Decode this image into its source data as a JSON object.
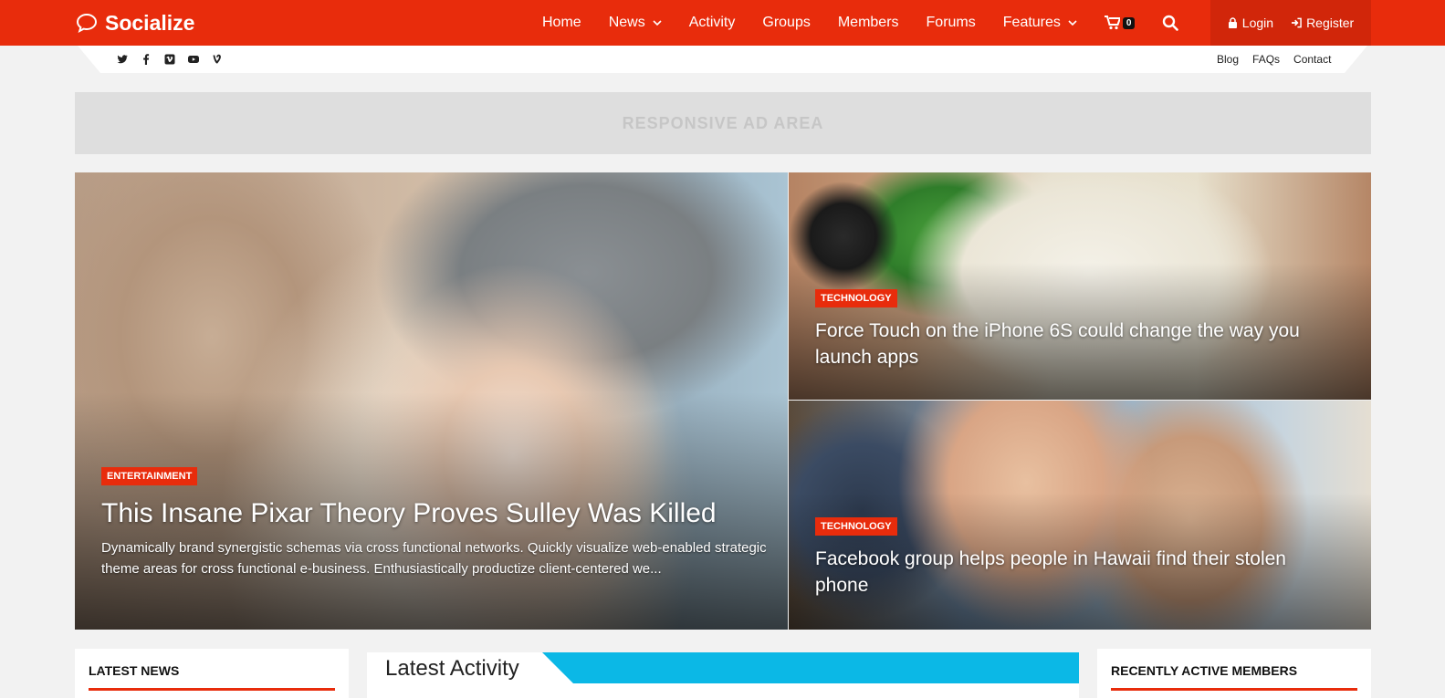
{
  "header": {
    "logo_text": "Socialize",
    "nav": [
      {
        "label": "Home",
        "has_dropdown": false
      },
      {
        "label": "News",
        "has_dropdown": true
      },
      {
        "label": "Activity",
        "has_dropdown": false
      },
      {
        "label": "Groups",
        "has_dropdown": false
      },
      {
        "label": "Members",
        "has_dropdown": false
      },
      {
        "label": "Forums",
        "has_dropdown": false
      },
      {
        "label": "Features",
        "has_dropdown": true
      }
    ],
    "cart_count": "0",
    "login_label": "Login",
    "register_label": "Register",
    "accent_color": "#e82c0c"
  },
  "subbar": {
    "social_icons": [
      "twitter-icon",
      "facebook-icon",
      "vimeo-icon",
      "youtube-icon",
      "vine-icon"
    ],
    "links": [
      "Blog",
      "FAQs",
      "Contact"
    ]
  },
  "ad": {
    "label": "RESPONSIVE AD AREA"
  },
  "featured": {
    "main": {
      "category": "ENTERTAINMENT",
      "title": "This Insane Pixar Theory Proves Sulley Was Killed",
      "excerpt": "Dynamically brand synergistic schemas via cross functional networks. Quickly visualize web-enabled strategic theme areas for cross functional e-business. Enthusiastically productize client-centered we..."
    },
    "top_right": {
      "category": "TECHNOLOGY",
      "title": "Force Touch on the iPhone 6S could change the way you launch apps"
    },
    "bottom_right": {
      "category": "TECHNOLOGY",
      "title": "Facebook group helps people in Hawaii find their stolen phone"
    }
  },
  "widgets": {
    "latest_news_title": "LATEST NEWS",
    "latest_activity_title": "Latest Activity",
    "recently_active_title": "RECENTLY ACTIVE MEMBERS",
    "activity_accent_color": "#0bb8e6"
  }
}
